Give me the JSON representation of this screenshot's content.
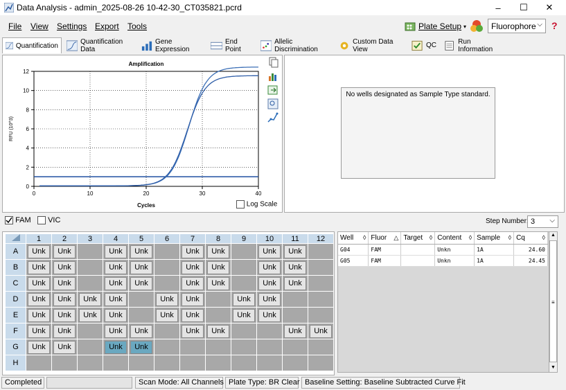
{
  "window": {
    "title": "Data Analysis - admin_2025-08-26 10-42-30_CT035821.pcrd",
    "minimize": "–",
    "maximize": "☐",
    "close": "✕"
  },
  "menu": [
    "File",
    "View",
    "Settings",
    "Export",
    "Tools"
  ],
  "toolbar": {
    "plate_setup": "Plate Setup",
    "fluorophore": "Fluorophore",
    "help": "?"
  },
  "tabs": [
    "Quantification",
    "Quantification Data",
    "Gene Expression",
    "End Point",
    "Allelic Discrimination",
    "Custom Data View",
    "QC",
    "Run Information"
  ],
  "chart_data": {
    "type": "line",
    "title": "Amplification",
    "xlabel": "Cycles",
    "ylabel": "RFU (10^3)",
    "xlim": [
      0,
      40
    ],
    "ylim": [
      0,
      12
    ],
    "x_ticks": [
      "0",
      "10",
      "20",
      "30",
      "40"
    ],
    "y_ticks": [
      "0",
      "2",
      "4",
      "6",
      "8",
      "10",
      "12"
    ],
    "threshold": 1.0,
    "series": [
      {
        "well": "G04",
        "color": "#3b6fb6",
        "max": 12.4,
        "mid": 27.6,
        "k": 0.62,
        "base": 0.05
      },
      {
        "well": "G05",
        "color": "#2e5da8",
        "max": 11.5,
        "mid": 27.3,
        "k": 0.62,
        "base": 0.05
      }
    ],
    "log_scale_label": "Log Scale",
    "log_scale": false
  },
  "standard_message": "No wells designated as Sample Type standard.",
  "fluor_toggles": [
    {
      "label": "FAM",
      "checked": true
    },
    {
      "label": "VIC",
      "checked": false
    }
  ],
  "step_number": {
    "label": "Step Number:",
    "value": "3"
  },
  "plate": {
    "columns": [
      "1",
      "2",
      "3",
      "4",
      "5",
      "6",
      "7",
      "8",
      "9",
      "10",
      "11",
      "12"
    ],
    "rows": [
      {
        "label": "A",
        "cells": [
          "Unk",
          "Unk",
          "",
          "Unk",
          "Unk",
          "",
          "Unk",
          "Unk",
          "",
          "Unk",
          "Unk",
          ""
        ]
      },
      {
        "label": "B",
        "cells": [
          "Unk",
          "Unk",
          "",
          "Unk",
          "Unk",
          "",
          "Unk",
          "Unk",
          "",
          "Unk",
          "Unk",
          ""
        ]
      },
      {
        "label": "C",
        "cells": [
          "Unk",
          "Unk",
          "",
          "Unk",
          "Unk",
          "",
          "Unk",
          "Unk",
          "",
          "Unk",
          "Unk",
          ""
        ]
      },
      {
        "label": "D",
        "cells": [
          "Unk",
          "Unk",
          "Unk",
          "Unk",
          "",
          "Unk",
          "Unk",
          "",
          "Unk",
          "Unk",
          "",
          ""
        ]
      },
      {
        "label": "E",
        "cells": [
          "Unk",
          "Unk",
          "Unk",
          "Unk",
          "",
          "Unk",
          "Unk",
          "",
          "Unk",
          "Unk",
          "",
          ""
        ]
      },
      {
        "label": "F",
        "cells": [
          "Unk",
          "Unk",
          "",
          "Unk",
          "Unk",
          "",
          "Unk",
          "Unk",
          "",
          "",
          "Unk",
          "Unk"
        ]
      },
      {
        "label": "G",
        "cells": [
          "Unk",
          "Unk",
          "",
          "Unk*",
          "Unk*",
          "",
          "",
          "",
          "",
          "",
          "",
          ""
        ]
      },
      {
        "label": "H",
        "cells": [
          "",
          "",
          "",
          "",
          "",
          "",
          "",
          "",
          "",
          "",
          "",
          ""
        ]
      }
    ]
  },
  "well_table": {
    "headers": [
      "Well",
      "Fluor",
      "Target",
      "Content",
      "Sample",
      "Cq"
    ],
    "header_icons": [
      "◊",
      "△",
      "◊",
      "◊",
      "◊",
      "◊"
    ],
    "rows": [
      [
        "G04",
        "FAM",
        "",
        "Unkn",
        "1A",
        "24.60"
      ],
      [
        "G05",
        "FAM",
        "",
        "Unkn",
        "1A",
        "24.45"
      ]
    ]
  },
  "status": {
    "state": "Completed",
    "scan_mode": "Scan Mode: All Channels",
    "plate_type": "Plate Type: BR Clear",
    "baseline": "Baseline Setting: Baseline Subtracted Curve Fit"
  }
}
